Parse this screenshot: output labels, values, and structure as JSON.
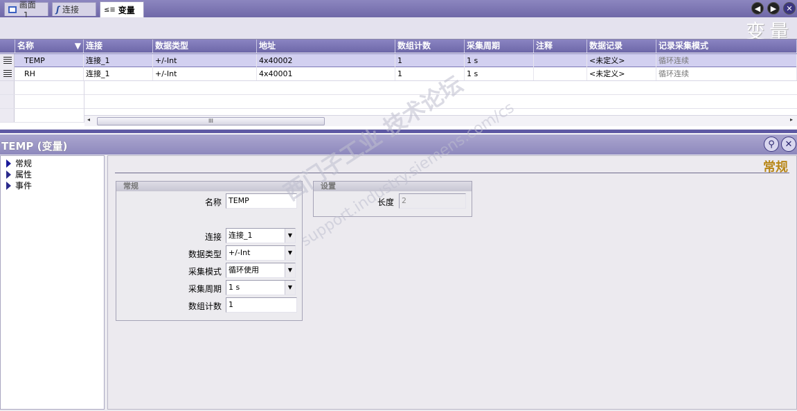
{
  "tabs": [
    {
      "label": "画面_1",
      "icon": "screen-icon"
    },
    {
      "label": "连接",
      "icon": "connection-icon"
    },
    {
      "label": "变量",
      "icon": "tag-icon"
    }
  ],
  "editor": {
    "title": "变量",
    "columns": [
      "名称",
      "连接",
      "数据类型",
      "地址",
      "数组计数",
      "采集周期",
      "注释",
      "数据记录",
      "记录采集模式"
    ],
    "rows": [
      {
        "name": "TEMP",
        "connection": "连接_1",
        "datatype": "+/-Int",
        "address": "4x40002",
        "array_count": "1",
        "cycle": "1 s",
        "comment": "",
        "data_log": "<未定义>",
        "log_mode": "循环连续"
      },
      {
        "name": "RH",
        "connection": "连接_1",
        "datatype": "+/-Int",
        "address": "4x40001",
        "array_count": "1",
        "cycle": "1 s",
        "comment": "",
        "data_log": "<未定义>",
        "log_mode": "循环连续"
      }
    ],
    "scroll_thumb_label": "III"
  },
  "properties": {
    "title": "TEMP (变量)",
    "nav": [
      "常规",
      "属性",
      "事件"
    ],
    "section_title": "常规",
    "general_group": {
      "title": "常规",
      "name_label": "名称",
      "name_value": "TEMP",
      "connection_label": "连接",
      "connection_value": "连接_1",
      "datatype_label": "数据类型",
      "datatype_value": "+/-Int",
      "acq_mode_label": "采集模式",
      "acq_mode_value": "循环使用",
      "acq_cycle_label": "采集周期",
      "acq_cycle_value": "1 s",
      "array_label": "数组计数",
      "array_value": "1"
    },
    "settings_group": {
      "title": "设置",
      "length_label": "长度",
      "length_value": "2"
    }
  },
  "watermark": {
    "line1": "西门子工业 技术论坛",
    "line2": "support.industry.siemens.com/cs"
  }
}
